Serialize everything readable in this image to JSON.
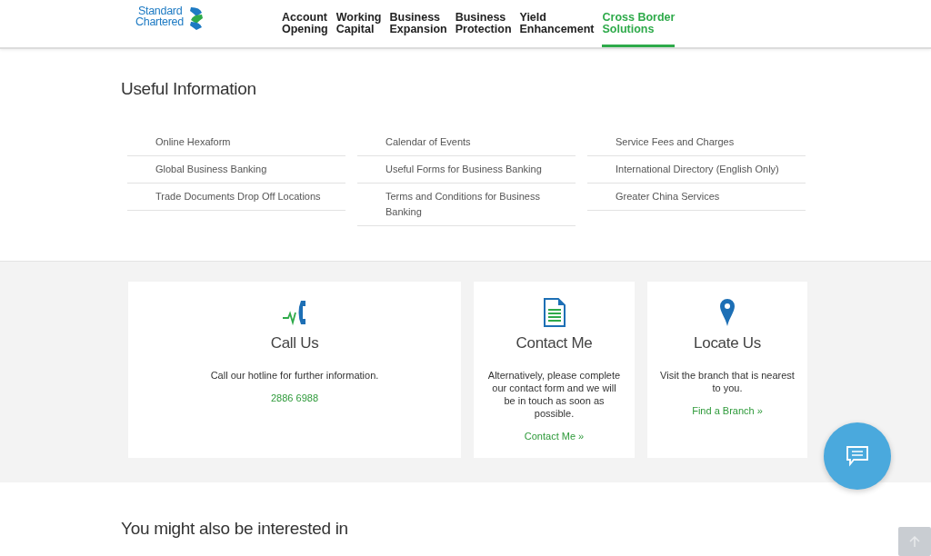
{
  "header": {
    "logo": [
      "Standard",
      "Chartered"
    ],
    "nav": [
      {
        "label": [
          "Account",
          "Opening"
        ],
        "selected": false
      },
      {
        "label": [
          "Working",
          "Capital"
        ],
        "selected": false
      },
      {
        "label": [
          "Business",
          "Expansion"
        ],
        "selected": false
      },
      {
        "label": [
          "Business",
          "Protection"
        ],
        "selected": false
      },
      {
        "label": [
          "Yield",
          "Enhancement"
        ],
        "selected": false
      },
      {
        "label": [
          "Cross Border",
          "Solutions"
        ],
        "selected": true
      }
    ]
  },
  "useful_information": {
    "title": "Useful Information",
    "columns": [
      [
        "Online Hexaform",
        "Global Business Banking",
        "Trade Documents Drop Off Locations"
      ],
      [
        "Calendar of Events",
        "Useful Forms for Business Banking",
        "Terms and Conditions for Business Banking"
      ],
      [
        "Service Fees and Charges",
        "International Directory (English Only)",
        "Greater China Services"
      ]
    ]
  },
  "contact_cards": [
    {
      "kind": "phone",
      "title": "Call Us",
      "text": "Call our hotline for further information.",
      "link": "2886 6988"
    },
    {
      "kind": "form",
      "title": "Contact Me",
      "text": "Alternatively, please complete our contact form and we will be in touch as soon as possible.",
      "link": "Contact Me »"
    },
    {
      "kind": "pin",
      "title": "Locate Us",
      "text": "Visit the branch that is nearest to you.",
      "link": "Find a Branch »"
    }
  ],
  "interested": {
    "title": "You might also be interested in"
  }
}
